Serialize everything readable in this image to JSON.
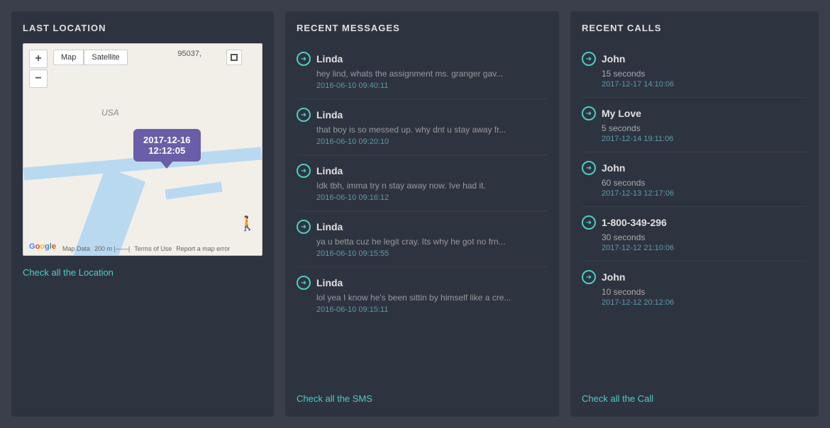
{
  "location": {
    "title": "LAST LOCATION",
    "map": {
      "zoom_in": "+",
      "zoom_out": "−",
      "type_map": "Map",
      "type_satellite": "Satellite",
      "date": "2017-12-16",
      "time": "12:12:05",
      "zipcode": "95037,",
      "country": "USA"
    },
    "check_link": "Check all the Location"
  },
  "messages": {
    "title": "RECENT MESSAGES",
    "items": [
      {
        "name": "Linda",
        "text": "hey lind, whats the assignment ms. granger gav...",
        "date": "2016-06-10 09:40:11"
      },
      {
        "name": "Linda",
        "text": "that boy is so messed up. why dnt u stay away fr...",
        "date": "2016-06-10 09:20:10"
      },
      {
        "name": "Linda",
        "text": "Idk tbh, imma try n stay away now. Ive had it.",
        "date": "2016-06-10 09:16:12"
      },
      {
        "name": "Linda",
        "text": "ya u betta cuz he legit cray. Its why he got no frn...",
        "date": "2016-06-10 09:15:55"
      },
      {
        "name": "Linda",
        "text": "lol yea I know he's been sittin by himself like a cre...",
        "date": "2016-06-10 09:15:11"
      }
    ],
    "check_link": "Check all the SMS"
  },
  "calls": {
    "title": "RECENT CALLS",
    "items": [
      {
        "name": "John",
        "duration": "15 seconds",
        "date": "2017-12-17 14:10:06"
      },
      {
        "name": "My Love",
        "duration": "5 seconds",
        "date": "2017-12-14 19:11:06"
      },
      {
        "name": "John",
        "duration": "60 seconds",
        "date": "2017-12-13 12:17:06"
      },
      {
        "name": "1-800-349-296",
        "duration": "30 seconds",
        "date": "2017-12-12 21:10:06"
      },
      {
        "name": "John",
        "duration": "10 seconds",
        "date": "2017-12-12 20:12:06"
      }
    ],
    "check_link": "Check all the Call"
  },
  "icons": {
    "arrow": "➜",
    "zoom_in": "+",
    "zoom_out": "−",
    "fullscreen": "⤢",
    "pegman": "🚶"
  }
}
